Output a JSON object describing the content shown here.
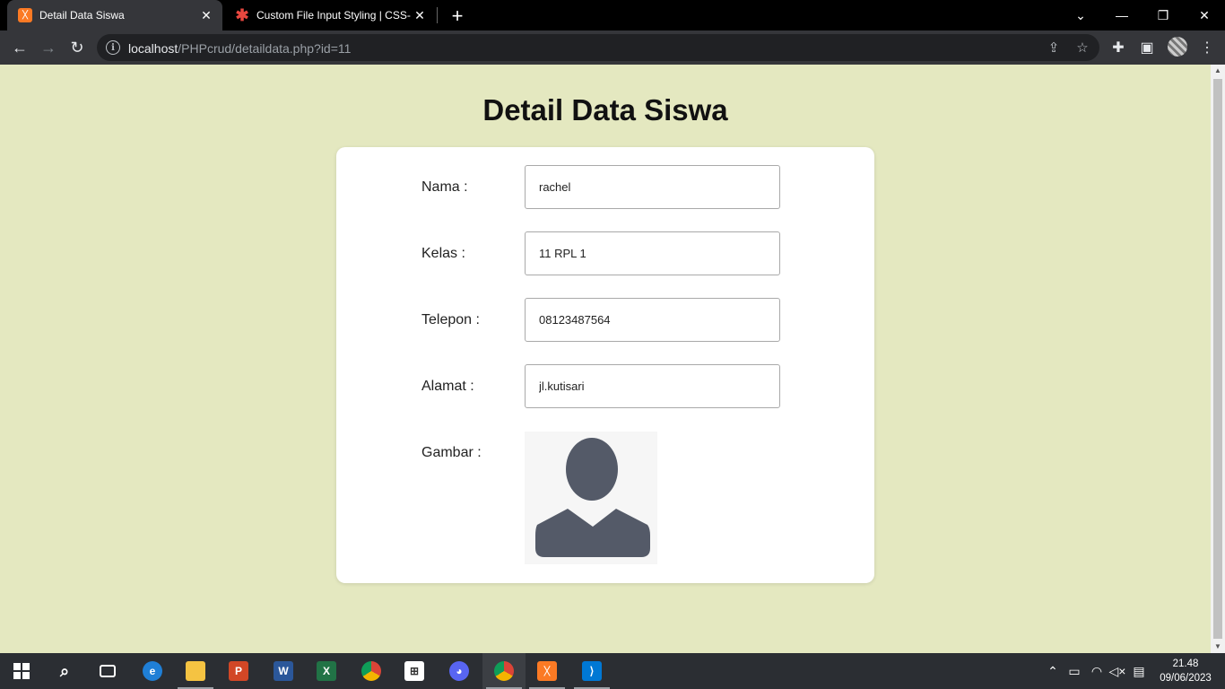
{
  "browser": {
    "tabs": [
      {
        "title": "Detail Data Siswa",
        "favicon": "xampp-icon",
        "active": true
      },
      {
        "title": "Custom File Input Styling | CSS-Tr",
        "favicon": "css-tricks-icon",
        "active": false
      }
    ],
    "address": {
      "host": "localhost",
      "path": "/PHPcrud/detaildata.php?id=11"
    }
  },
  "page": {
    "title": "Detail Data Siswa",
    "background_color": "#e4e8c0",
    "fields": [
      {
        "label": "Nama :",
        "value": "rachel"
      },
      {
        "label": "Kelas :",
        "value": "11 RPL 1"
      },
      {
        "label": "Telepon :",
        "value": "08123487564"
      },
      {
        "label": "Alamat :",
        "value": "jl.kutisari"
      }
    ],
    "image_field": {
      "label": "Gambar :",
      "image": "user-avatar-placeholder"
    }
  },
  "taskbar": {
    "apps": [
      "file-explorer-icon",
      "edge-icon",
      "powerpoint-icon",
      "word-icon",
      "excel-icon",
      "chrome-icon",
      "store-icon",
      "discord-icon",
      "chrome-active-icon",
      "xampp-icon",
      "vscode-icon"
    ],
    "clock": {
      "time": "21.48",
      "date": "09/06/2023"
    }
  }
}
